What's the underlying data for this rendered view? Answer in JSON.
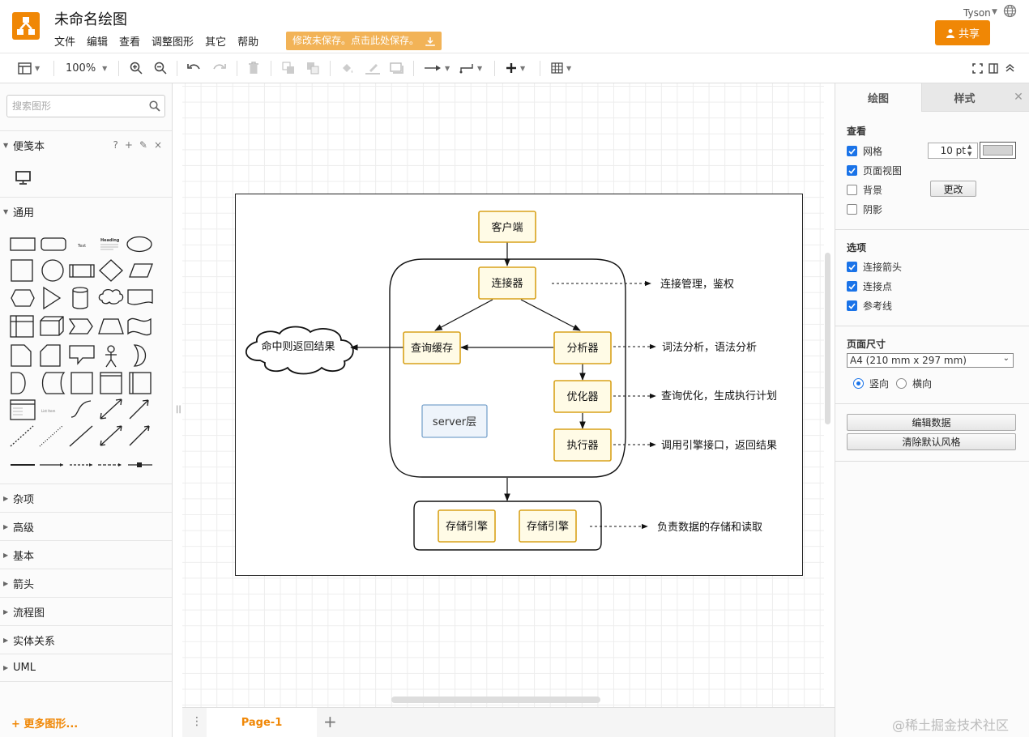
{
  "header": {
    "title": "未命名绘图",
    "menu": [
      "文件",
      "编辑",
      "查看",
      "调整图形",
      "其它",
      "帮助"
    ],
    "unsaved_notice": "修改未保存。点击此处保存。",
    "user": "Tyson",
    "share_label": "共享",
    "brand_color": "#f08705"
  },
  "toolbar": {
    "zoom": "100%"
  },
  "sidebar": {
    "search_placeholder": "搜索图形",
    "scratchpad": "便笺本",
    "scratchpad_actions": [
      "?",
      "+",
      "✎",
      "×"
    ],
    "general": "通用",
    "shape_text_label": "Text",
    "shape_heading_label": "Heading",
    "shape_list_label": "List Item",
    "sections": [
      "杂项",
      "高级",
      "基本",
      "箭头",
      "流程图",
      "实体关系",
      "UML"
    ],
    "more_shapes": "+ 更多图形..."
  },
  "diagram": {
    "nodes": {
      "client": "客户端",
      "connector": "连接器",
      "query_cache": "查询缓存",
      "analyzer": "分析器",
      "optimizer": "优化器",
      "executor": "执行器",
      "server_layer": "server层",
      "engine1": "存储引擎",
      "engine2": "存储引擎",
      "cloud": "命中则返回结果"
    },
    "annotations": {
      "connector": "连接管理，鉴权",
      "analyzer": "词法分析，语法分析",
      "optimizer": "查询优化，生成执行计划",
      "executor": "调用引擎接口，返回结果",
      "storage": "负责数据的存储和读取"
    }
  },
  "pages": {
    "tab": "Page-1"
  },
  "format_panel": {
    "tab_diagram": "绘图",
    "tab_style": "样式",
    "view_title": "查看",
    "grid": "网格",
    "grid_size": "10 pt",
    "page_view": "页面视图",
    "background": "背景",
    "change_button": "更改",
    "shadow": "阴影",
    "options_title": "选项",
    "connection_arrows": "连接箭头",
    "connection_points": "连接点",
    "guides": "参考线",
    "page_size_title": "页面尺寸",
    "page_size": "A4 (210 mm x 297 mm)",
    "portrait": "竖向",
    "landscape": "横向",
    "edit_data": "编辑数据",
    "clear_style": "清除默认风格",
    "grid_color": "#d3d3d3"
  },
  "watermark": "@稀土掘金技术社区"
}
